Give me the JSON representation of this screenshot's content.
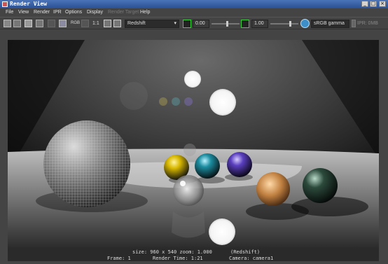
{
  "window": {
    "title": "Render View",
    "controls": {
      "minimize": "_",
      "maximize": "□",
      "close": "×"
    }
  },
  "menu": [
    {
      "label": "File",
      "enabled": true
    },
    {
      "label": "View",
      "enabled": true
    },
    {
      "label": "Render",
      "enabled": true
    },
    {
      "label": "IPR",
      "enabled": true
    },
    {
      "label": "Options",
      "enabled": true
    },
    {
      "label": "Display",
      "enabled": true
    },
    {
      "label": "Render Target",
      "enabled": false
    },
    {
      "label": "Help",
      "enabled": true
    }
  ],
  "toolbar": {
    "rgb_label": "RGB",
    "ratio_label": "1:1",
    "renderer": "Redshift",
    "exposure_value": "0.00",
    "gamma_value": "1.00",
    "color_space": "sRGB gamma",
    "ipr_label": "IPR: 0MB",
    "exposure_level": 0.55,
    "gamma_level": 0.7
  },
  "status": {
    "size": "size: 960 x 540 zoom: 1.000",
    "renderer": "(Redshift)",
    "frame": "Frame: 1",
    "render_time": "Render Time: 1:21",
    "camera": "Camera: camera1"
  },
  "colors": {
    "accent_green": "#35d035",
    "title_blue": "#3a63a8",
    "bg": "#444444"
  }
}
